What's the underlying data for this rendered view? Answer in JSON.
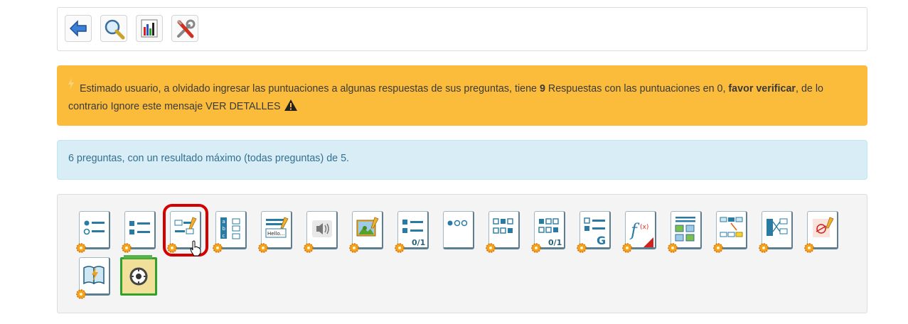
{
  "toolbar": {
    "buttons": [
      {
        "icon": "back-arrow-icon"
      },
      {
        "icon": "magnifier-icon"
      },
      {
        "icon": "bar-chart-icon"
      },
      {
        "icon": "tools-icon"
      }
    ]
  },
  "warning": {
    "text_before": "Estimado usuario, a olvidado ingresar las puntuaciones a algunas respuestas de sus preguntas, tiene ",
    "count": "9",
    "text_middle": " Respuestas con las puntuaciones en 0, ",
    "bold_action": "favor verificar",
    "text_after": ", de lo",
    "line2": "contrario Ignore este mensaje VER DETALLES",
    "color": "#fbbc3c"
  },
  "info": {
    "text": "6 preguntas, con un resultado máximo (todas preguntas) de 5.",
    "color": "#d9edf7"
  },
  "question_types": {
    "items": [
      {
        "icon": "single-choice-icon"
      },
      {
        "icon": "multiple-choice-icon"
      },
      {
        "icon": "fill-in-blanks-icon",
        "selected": true
      },
      {
        "icon": "matching-icon"
      },
      {
        "icon": "open-answer-icon",
        "label": "Hello..."
      },
      {
        "icon": "oral-expression-icon"
      },
      {
        "icon": "hotspot-image-icon"
      },
      {
        "icon": "exact-selection-icon",
        "label": "0/1"
      },
      {
        "icon": "unique-answer-no-option-icon"
      },
      {
        "icon": "multiple-answer-true-false-icon"
      },
      {
        "icon": "combination-true-false-icon",
        "label": "0/1"
      },
      {
        "icon": "global-multiple-answer-icon",
        "label": "G"
      },
      {
        "icon": "calculated-answer-icon",
        "label": "f(x)"
      },
      {
        "icon": "image-zones-icon"
      },
      {
        "icon": "drag-and-drop-icon"
      },
      {
        "icon": "match-arrows-icon"
      },
      {
        "icon": "annotation-icon"
      },
      {
        "icon": "reading-comprehension-icon"
      },
      {
        "icon": "recycle-existing-questions-icon"
      }
    ]
  }
}
